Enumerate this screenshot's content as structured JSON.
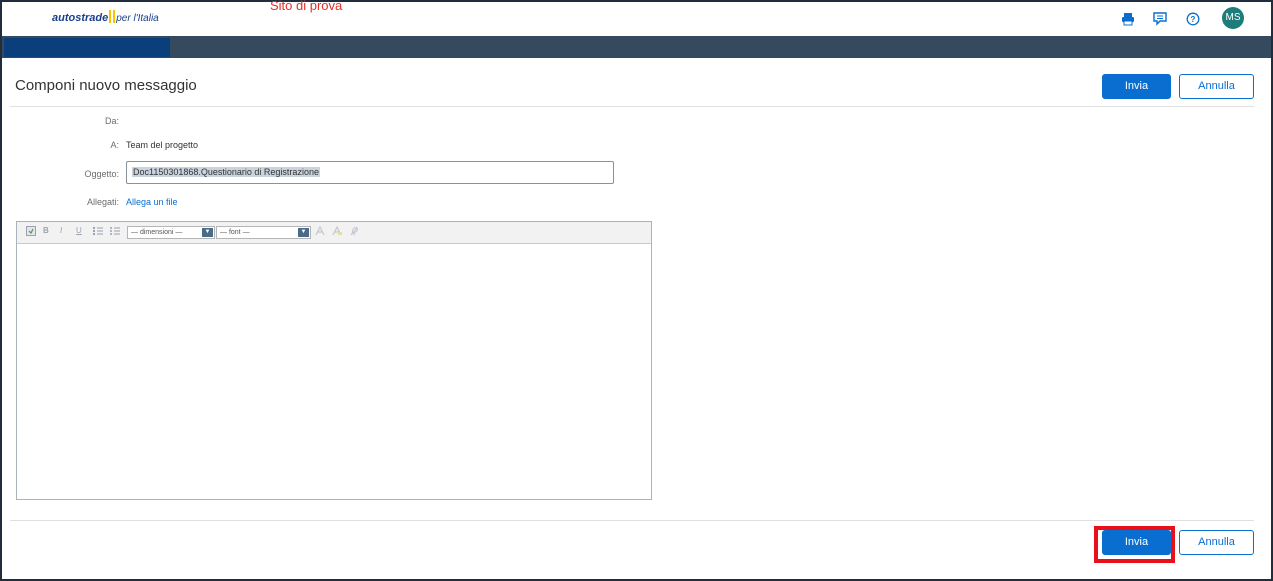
{
  "header": {
    "logo_brand": "autostrade",
    "logo_sub": "per l'Italia",
    "site_label": "Sito di prova",
    "icons": [
      "printer-icon",
      "feedback-icon",
      "help-icon"
    ],
    "avatar_initials": "MS"
  },
  "page": {
    "title": "Componi nuovo messaggio"
  },
  "actions": {
    "send_label": "Invia",
    "cancel_label": "Annulla"
  },
  "form": {
    "from_label": "Da:",
    "from_value": "",
    "to_label": "A:",
    "to_value": "Team del progetto",
    "subject_label": "Oggetto:",
    "subject_value": "Doc1150301868.Questionario di Registrazione",
    "attachments_label": "Allegati:",
    "attach_link": "Allega un file"
  },
  "editor": {
    "toolbar": {
      "bold": "B",
      "italic": "I",
      "underline": "U",
      "size_select": "— dimensioni —",
      "font_select": "— font —"
    },
    "body": ""
  },
  "colors": {
    "primary": "#0a6ed1",
    "nav_band": "#354a5f",
    "highlight": "#e8101b",
    "site_label": "#e0312b",
    "avatar": "#1e7d7a"
  }
}
